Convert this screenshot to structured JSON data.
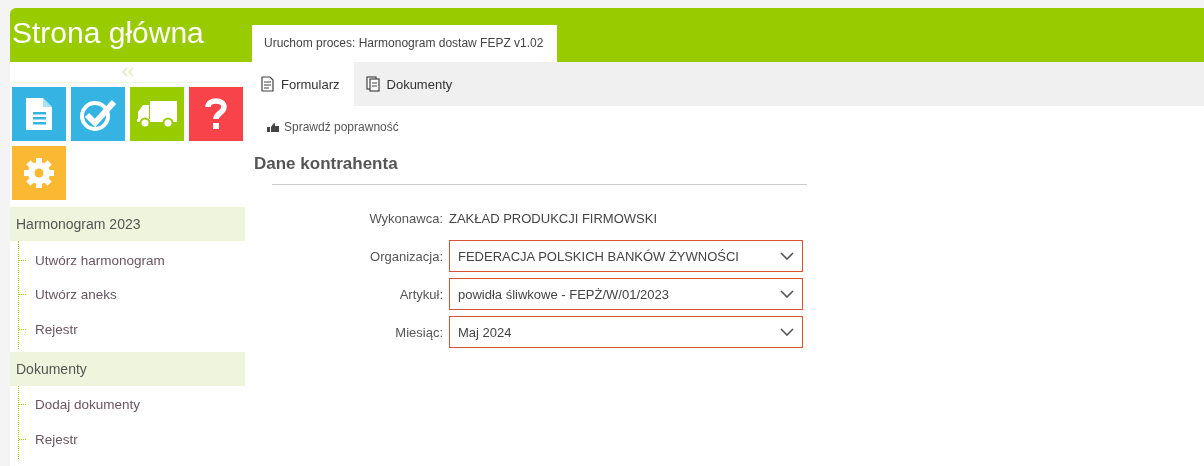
{
  "header": {
    "title": "Strona główna"
  },
  "process_tab": {
    "label": "Uruchom proces: Harmonogram dostaw FEPZ v1.02"
  },
  "sidebar": {
    "tiles": [
      {
        "kind": "document",
        "color": "#35b4e4"
      },
      {
        "kind": "check",
        "color": "#35b4e4"
      },
      {
        "kind": "truck",
        "color": "#99cc00"
      },
      {
        "kind": "help",
        "color": "#f9434b"
      },
      {
        "kind": "settings",
        "color": "#fbb832"
      }
    ],
    "groups": [
      {
        "title": "Harmonogram 2023",
        "children": [
          {
            "label": "Utwórz harmonogram"
          },
          {
            "label": "Utwórz aneks"
          },
          {
            "label": "Rejestr"
          }
        ]
      },
      {
        "title": "Dokumenty",
        "children": [
          {
            "label": "Dodaj dokumenty"
          },
          {
            "label": "Rejestr"
          }
        ]
      }
    ]
  },
  "tabs": [
    {
      "label": "Formularz",
      "selected": true,
      "kind": "form"
    },
    {
      "label": "Dokumenty",
      "selected": false,
      "kind": "documents"
    }
  ],
  "validate_button": {
    "label": "Sprawdź poprawność"
  },
  "section": {
    "title": "Dane kontrahenta"
  },
  "fields": [
    {
      "kind": "text",
      "label": "Wykonawca:",
      "value": "ZAKŁAD PRODUKCJI FIRMOWSKI"
    },
    {
      "kind": "select",
      "label": "Organizacja:",
      "value": "FEDERACJA POLSKICH BANKÓW ŻYWNOŚCI"
    },
    {
      "kind": "select",
      "label": "Artykuł:",
      "value": "powidła śliwkowe - FEPŻ/W/01/2023"
    },
    {
      "kind": "select",
      "label": "Miesiąc:",
      "value": "Maj 2024"
    }
  ]
}
